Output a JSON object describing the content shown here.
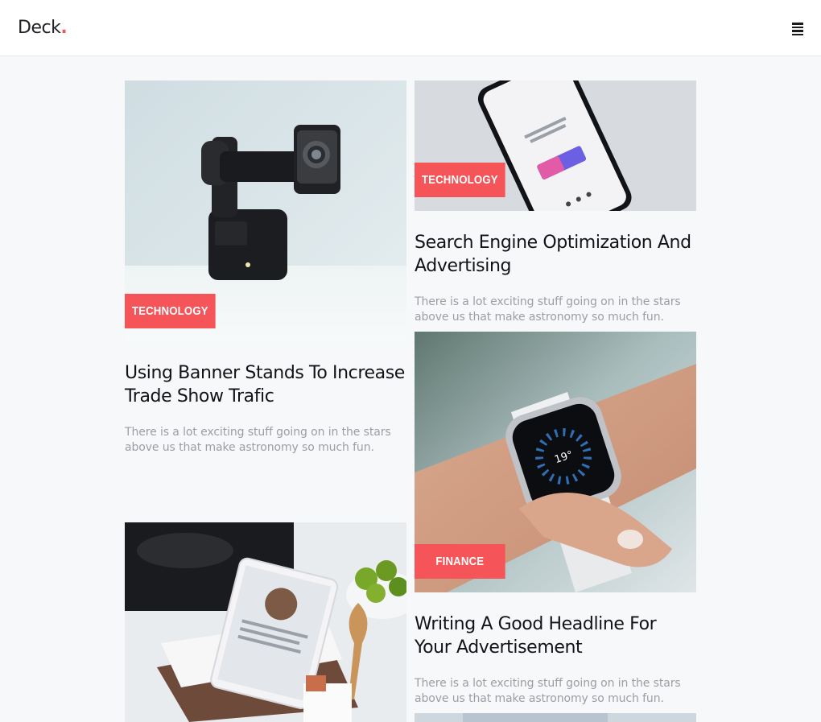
{
  "brand": {
    "name": "Deck",
    "dot": ".",
    "accent_color": "#f25555"
  },
  "header": {
    "menu_icon": "hamburger-menu-icon"
  },
  "cards": [
    {
      "category": "TECHNOLOGY",
      "title": "Using Banner Stands To Increase Trade Show Trafic",
      "excerpt": "There is a lot exciting stuff going on in the stars above us that make astronomy so much fun.",
      "image": "gimbal-camera"
    },
    {
      "category": "TECHNOLOGY",
      "title": "Search Engine Optimization And Advertising",
      "excerpt": "There is a lot exciting stuff going on in the stars above us that make astronomy so much fun.",
      "image": "smartphone"
    },
    {
      "category": "FINANCE",
      "title": "Writing A Good Headline For Your Advertisement",
      "excerpt": "There is a lot exciting stuff going on in the stars above us that make astronomy so much fun.",
      "image": "smartwatch"
    },
    {
      "image": "tablet-kitchen"
    }
  ],
  "colors": {
    "badge": "#f55458",
    "title": "#111318",
    "excerpt": "#9b9ea4",
    "background": "#f7f8fa"
  }
}
